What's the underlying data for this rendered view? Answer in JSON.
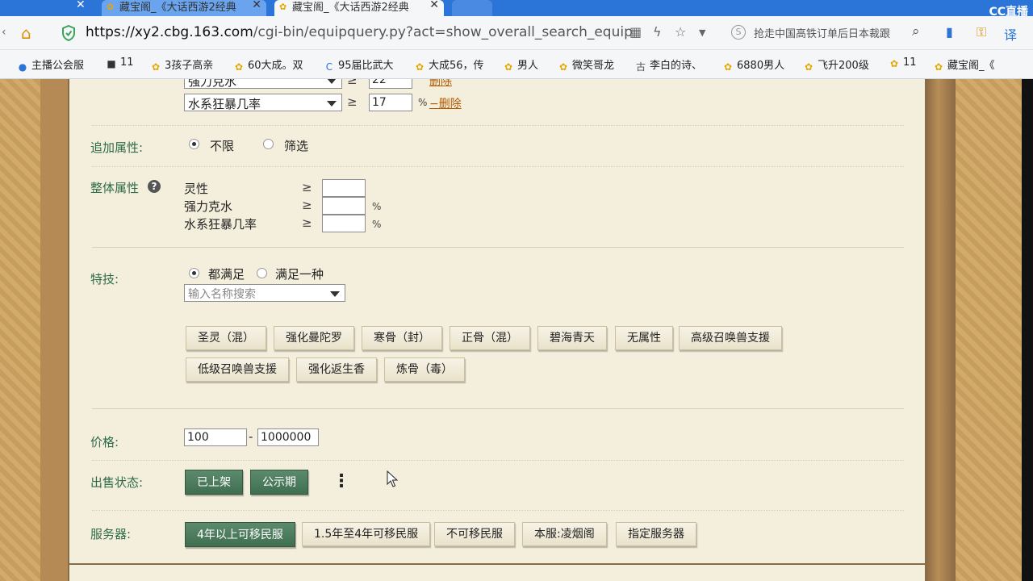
{
  "browser": {
    "tabs": [
      {
        "label": "藏宝阁_《大话西游2经典",
        "active": false
      },
      {
        "label": "藏宝阁_《大话西游2经典",
        "active": true
      }
    ],
    "badge": "CC直播",
    "url_host": "https://xy2.cbg.163.com",
    "url_path": "/cgi-bin/equipquery.py?act=show_overall_search_equip",
    "search_suggestion": "抢走中国高铁订单后日本裁跟",
    "bookmarks": [
      "主播公会服",
      "11",
      "3孩子高亲",
      "60大成。双",
      "95届比武大",
      "大成56，传",
      "男人",
      "微笑哥龙",
      "李白的诗、",
      "6880男人",
      "飞升200级",
      "11",
      "藏宝阁_《"
    ]
  },
  "form": {
    "attr_row_partial": {
      "select": "强力克水",
      "value": "22",
      "delete": "删除"
    },
    "attr_row": {
      "select": "水系狂暴几率",
      "ge": "≥",
      "value": "17",
      "unit": "%",
      "delete": "−删除"
    },
    "extra_attr": {
      "label": "追加属性:",
      "options": [
        "不限",
        "筛选"
      ],
      "selected": 0
    },
    "overall_attr": {
      "label": "整体属性",
      "help": "?",
      "rows": [
        {
          "name": "灵性",
          "ge": "≥",
          "unit": ""
        },
        {
          "name": "强力克水",
          "ge": "≥",
          "unit": "%"
        },
        {
          "name": "水系狂暴几率",
          "ge": "≥",
          "unit": "%"
        }
      ]
    },
    "skills": {
      "label": "特技:",
      "match_options": [
        "都满足",
        "满足一种"
      ],
      "match_selected": 0,
      "search_placeholder": "输入名称搜索",
      "buttons": [
        "圣灵（混）",
        "强化曼陀罗",
        "寒骨（封）",
        "正骨（混）",
        "碧海青天",
        "无属性",
        "高级召唤兽支援",
        "低级召唤兽支援",
        "强化返生香",
        "炼骨（毒）"
      ]
    },
    "price": {
      "label": "价格:",
      "min": "100",
      "dash": "-",
      "max": "1000000"
    },
    "sale_status": {
      "label": "出售状态:",
      "options": [
        "已上架",
        "公示期"
      ],
      "more": "⋮"
    },
    "server": {
      "label": "服务器:",
      "options": [
        "4年以上可移民服",
        "1.5年至4年可移民服",
        "不可移民服",
        "本服:凌烟阁",
        "指定服务器"
      ],
      "selected": 0
    }
  },
  "colors": {
    "accent_green": "#3f6e51",
    "label_green": "#2c6a4a",
    "panel_bg": "#f4efdc",
    "link_orange": "#b35a00"
  }
}
